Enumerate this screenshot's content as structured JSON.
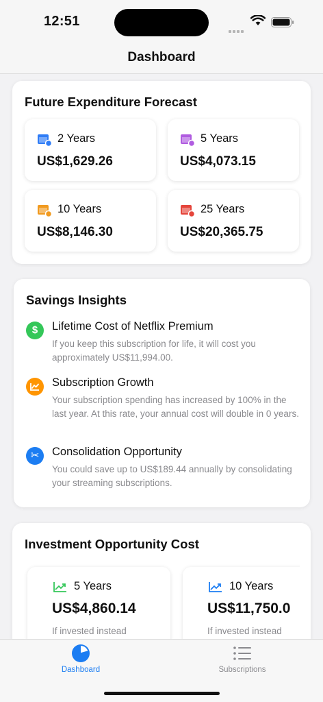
{
  "status_bar": {
    "time": "12:51"
  },
  "nav": {
    "title": "Dashboard"
  },
  "forecast": {
    "title": "Future Expenditure Forecast",
    "items": [
      {
        "label": "2 Years",
        "value": "US$1,629.26",
        "icon": "calendar-icon",
        "color": "#2f7cf6"
      },
      {
        "label": "5 Years",
        "value": "US$4,073.15",
        "icon": "calendar-icon",
        "color": "#b05ce0"
      },
      {
        "label": "10 Years",
        "value": "US$8,146.30",
        "icon": "calendar-icon",
        "color": "#f19a1f"
      },
      {
        "label": "25 Years",
        "value": "US$20,365.75",
        "icon": "calendar-icon",
        "color": "#e5453b"
      }
    ]
  },
  "insights": {
    "title": "Savings Insights",
    "items": [
      {
        "title": "Lifetime Cost of Netflix Premium",
        "description": "If you keep this subscription for life, it will cost you approximately US$11,994.00.",
        "icon": "dollar-icon",
        "glyph": "$",
        "color": "#34c759"
      },
      {
        "title": "Subscription Growth",
        "description": "Your subscription spending has increased by 100% in the last year. At this rate, your annual cost will double in 0 years.",
        "icon": "chart-up-icon",
        "color": "#ff9500"
      },
      {
        "title": "Consolidation Opportunity",
        "description": "You could save up to US$189.44 annually by consolidating your streaming subscriptions.",
        "icon": "scissors-icon",
        "glyph": "✂",
        "color": "#1c7df2"
      }
    ]
  },
  "investment": {
    "title": "Investment Opportunity Cost",
    "items": [
      {
        "label": "5 Years",
        "value": "US$4,860.14",
        "note": "If invested instead",
        "icon": "trend-up-icon",
        "color": "#34c759"
      },
      {
        "label": "10 Years",
        "value": "US$11,750.0",
        "note": "If invested instead",
        "icon": "trend-up-icon",
        "color": "#1c7df2"
      }
    ]
  },
  "tabs": [
    {
      "label": "Dashboard",
      "icon": "pie-chart-icon",
      "selected": true,
      "color": "#1c7df2"
    },
    {
      "label": "Subscriptions",
      "icon": "list-icon",
      "selected": false,
      "color": "#8a8a8e"
    }
  ]
}
